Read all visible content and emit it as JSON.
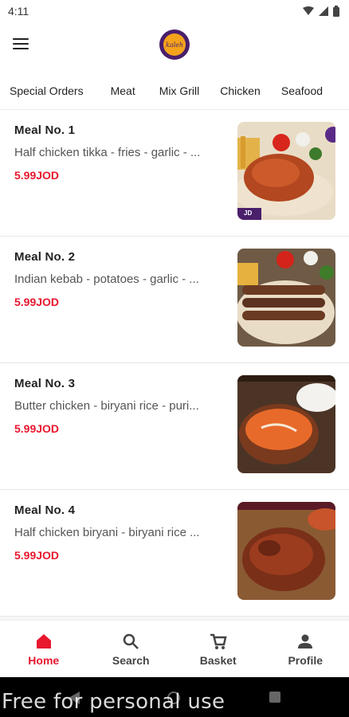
{
  "status": {
    "time": "4:11"
  },
  "app": {
    "logo_text": "kaleh"
  },
  "tabs": [
    {
      "label": "Special Orders"
    },
    {
      "label": "Meat"
    },
    {
      "label": "Mix Grill"
    },
    {
      "label": "Chicken"
    },
    {
      "label": "Seafood"
    }
  ],
  "meals": [
    {
      "title": "Meal No. 1",
      "desc": "Half chicken tikka - fries - garlic - ...",
      "price": "5.99JOD",
      "image_badge": "JD"
    },
    {
      "title": "Meal No. 2",
      "desc": "Indian kebab - potatoes - garlic - ...",
      "price": "5.99JOD"
    },
    {
      "title": "Meal No. 3",
      "desc": "Butter chicken - biryani rice - puri...",
      "price": "5.99JOD"
    },
    {
      "title": "Meal No. 4",
      "desc": "Half chicken biryani - biryani rice ...",
      "price": "5.99JOD"
    }
  ],
  "nav": [
    {
      "label": "Home",
      "icon": "home-icon",
      "active": true
    },
    {
      "label": "Search",
      "icon": "search-icon"
    },
    {
      "label": "Basket",
      "icon": "cart-icon"
    },
    {
      "label": "Profile",
      "icon": "person-icon"
    }
  ],
  "colors": {
    "accent": "#e8172e",
    "logo_bg": "#4a1f6b",
    "logo_inner": "#f4a31b",
    "tab_indicator": "#f08a8a"
  },
  "watermark": "Free for personal use"
}
